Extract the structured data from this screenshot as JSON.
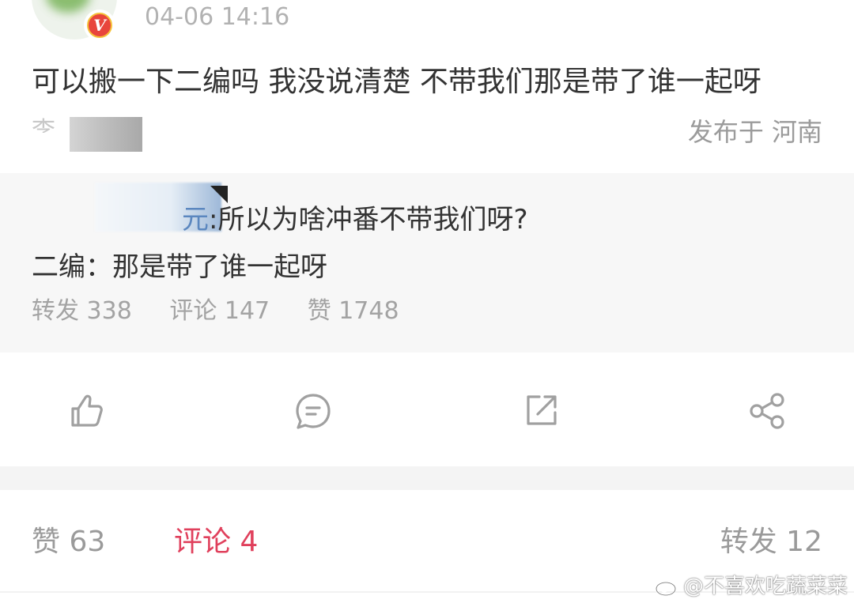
{
  "post": {
    "time": "04-06 14:16",
    "text": "可以搬一下二编吗 我没说清楚 不带我们那是带了谁一起呀",
    "source_prefix": "李",
    "location": "发布于 河南"
  },
  "quote": {
    "name_visible": "元",
    "line1_text": ":所以为啥冲番不带我们呀?",
    "line2_text": "二编：那是带了谁一起呀",
    "stats": {
      "repost": "转发 338",
      "comment": "评论 147",
      "like": "赞 1748"
    }
  },
  "actions": {
    "like_icon": "thumbs-up-icon",
    "comment_icon": "comment-icon",
    "share_external_icon": "open-external-icon",
    "share_icon": "share-icon"
  },
  "tabs": {
    "likes": "赞 63",
    "comments": "评论 4",
    "reposts": "转发 12"
  },
  "watermark": "@不喜欢吃蔬菜菜",
  "colors": {
    "accent_red": "#e0405c",
    "link_blue": "#5b87bf",
    "badge_red": "#e8453c",
    "text_gray": "#9a9a9a"
  }
}
